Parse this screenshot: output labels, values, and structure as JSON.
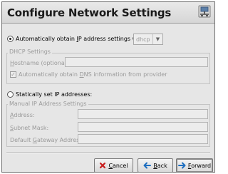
{
  "header": {
    "title": "Configure Network Settings",
    "icon": "network-icon"
  },
  "auto": {
    "label_pre": "Automatically obtain ",
    "label_u": "I",
    "label_post": "P address settings with:",
    "selected": true,
    "method": "dhcp"
  },
  "dhcp": {
    "group_title": "DHCP Settings",
    "hostname_pre": "",
    "hostname_u": "H",
    "hostname_post": "ostname (optional):",
    "hostname_value": "",
    "dns_pre": "Automatically obtain ",
    "dns_u": "D",
    "dns_post": "NS information from provider",
    "dns_checked": true
  },
  "static": {
    "label": "Statically set IP addresses:",
    "selected": false
  },
  "manual": {
    "group_title": "Manual IP Address Settings",
    "address_pre": "",
    "address_u": "A",
    "address_post": "ddress:",
    "subnet_pre": "",
    "subnet_u": "S",
    "subnet_post": "ubnet Mask:",
    "gateway_pre": "Default ",
    "gateway_u": "G",
    "gateway_post": "ateway Address:",
    "address_value": "",
    "subnet_value": "",
    "gateway_value": ""
  },
  "buttons": {
    "cancel_u": "C",
    "cancel_rest": "ancel",
    "back_u": "B",
    "back_rest": "ack",
    "forward_u": "F",
    "forward_rest": "orward"
  },
  "colors": {
    "disabled_text": "#9a9a9a",
    "cancel_icon": "#c81e1e",
    "arrow_icon": "#1f6fc0"
  }
}
